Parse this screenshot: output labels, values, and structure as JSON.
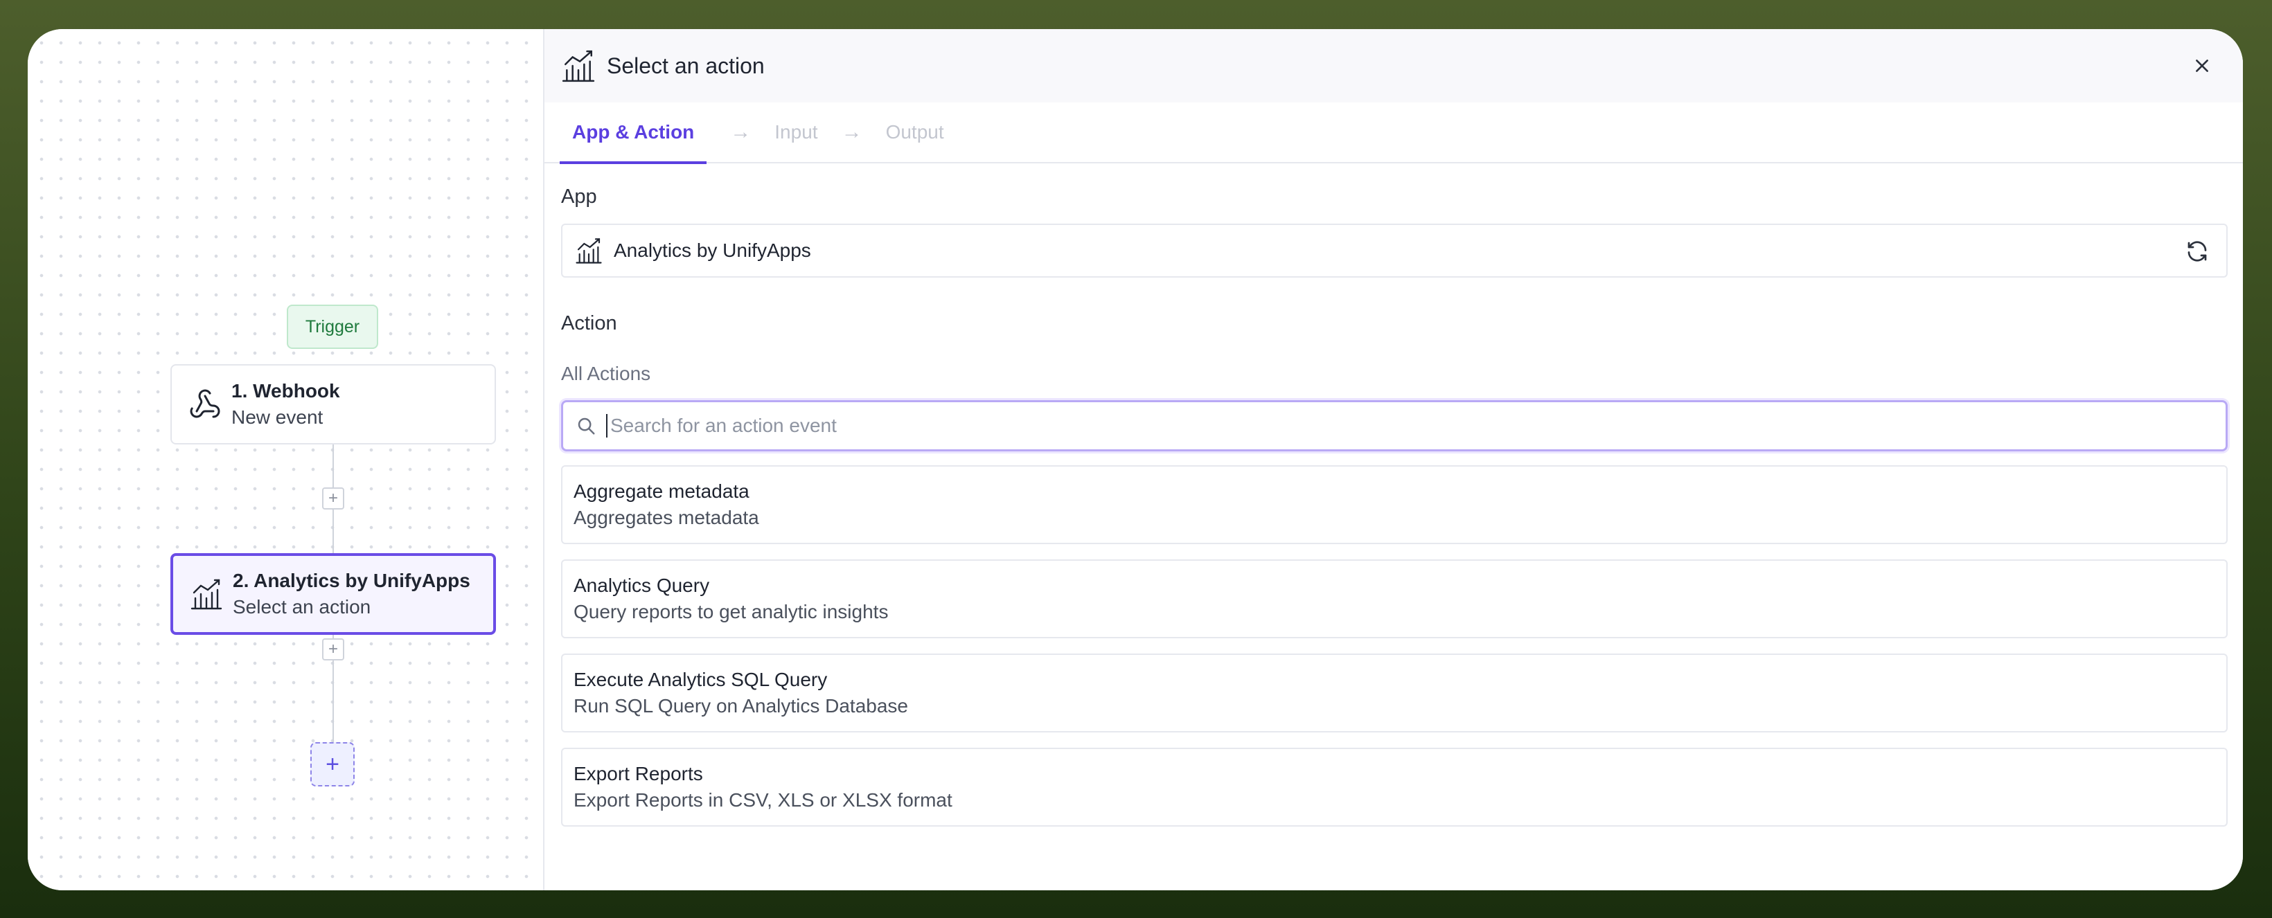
{
  "canvas": {
    "trigger_badge": "Trigger",
    "nodes": [
      {
        "title": "1. Webhook",
        "subtitle": "New event",
        "icon": "webhook-icon"
      },
      {
        "title": "2. Analytics by UnifyApps",
        "subtitle": "Select an action",
        "icon": "analytics-chart-icon"
      }
    ],
    "add_step_symbol": "+"
  },
  "panel": {
    "title": "Select an action",
    "header_icon": "analytics-chart-icon",
    "tabs": [
      {
        "label": "App & Action",
        "active": true
      },
      {
        "label": "Input",
        "active": false
      },
      {
        "label": "Output",
        "active": false
      }
    ],
    "tab_arrow": "→",
    "app_label": "App",
    "app_name": "Analytics by UnifyApps",
    "action_label": "Action",
    "all_actions_label": "All Actions",
    "search": {
      "placeholder": "Search for an action event",
      "value": ""
    },
    "actions": [
      {
        "title": "Aggregate metadata",
        "description": "Aggregates metadata"
      },
      {
        "title": "Analytics Query",
        "description": "Query reports to get analytic insights"
      },
      {
        "title": "Execute Analytics SQL Query",
        "description": "Run SQL Query on Analytics Database"
      },
      {
        "title": "Export Reports",
        "description": "Export Reports in CSV, XLS or XLSX format"
      }
    ]
  },
  "colors": {
    "accent": "#5b3fe0",
    "trigger_bg": "#e9f8ee",
    "trigger_text": "#1f7a3d",
    "background_frame": "#3a4f22"
  }
}
